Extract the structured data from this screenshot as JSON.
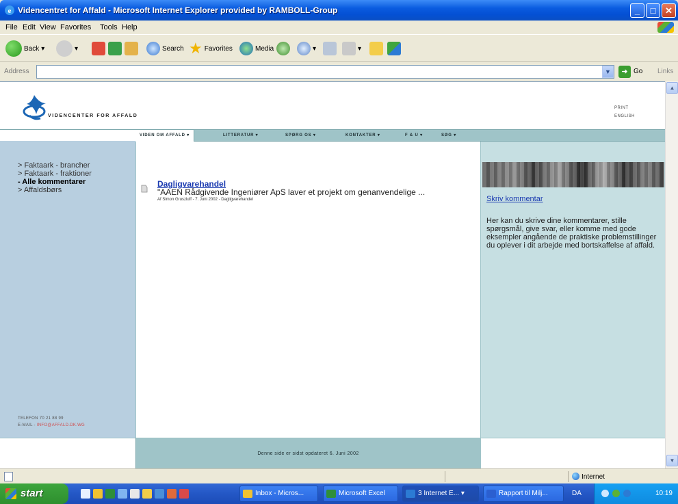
{
  "window": {
    "title": "Videncentret for Affald - Microsoft Internet Explorer provided by RAMBOLL-Group"
  },
  "menu": [
    "File",
    "Edit",
    "View",
    "Favorites",
    "Tools",
    "Help"
  ],
  "toolbar": {
    "back_label": "Back",
    "search_label": "Search",
    "favorites_label": "Favorites",
    "media_label": "Media"
  },
  "address": {
    "label": "Address",
    "value": "",
    "go_label": "Go",
    "links_label": "Links"
  },
  "site": {
    "logo_text": "VIDENCENTER FOR AFFALD",
    "lang_links": [
      "PRINT",
      "ENGLISH"
    ],
    "nav": [
      {
        "label": "VIDEN OM AFFALD ▾",
        "active": true
      },
      {
        "label": "LITTERATUR ▾",
        "active": false
      },
      {
        "label": "SPØRG OS ▾",
        "active": false
      },
      {
        "label": "KONTAKTER ▾",
        "active": false
      },
      {
        "label": "F & U ▾",
        "active": false
      },
      {
        "label": "SØG ▾",
        "active": false
      }
    ],
    "sidebar": [
      {
        "label": "> Faktaark - brancher",
        "active": false
      },
      {
        "label": "> Faktaark - fraktioner",
        "active": false
      },
      {
        "label": "- Alle kommentarer",
        "active": true
      },
      {
        "label": "> Affaldsbørs",
        "active": false
      }
    ],
    "contact": {
      "phone": "TELEFON 70 21 88 99",
      "email_label": "E-MAIL -",
      "email": "INFO@AFFALD.DK.WG"
    },
    "article": {
      "title": "Dagligvarehandel",
      "excerpt": "\"AAEN Rådgivende Ingeniører ApS laver et projekt om genanvendelige ...",
      "meta": "Af Simon Gruszluff - 7. Juni 2002 - Dagligvarehandel"
    },
    "right": {
      "cta": "Skriv kommentar",
      "description": "Her kan du skrive dine kommentarer, stille spørgsmål, give svar, eller komme med gode eksempler angående de praktiske problemstillinger du oplever i dit arbejde med bortskaffelse af affald."
    },
    "footer": "Denne side er sidst opdateret 6. Juni 2002"
  },
  "status": {
    "zone": "Internet"
  },
  "taskbar": {
    "start": "start",
    "tasks": [
      {
        "label": "Inbox - Micros...",
        "icon_color": "#f1c232",
        "active": false
      },
      {
        "label": "Microsoft Excel",
        "icon_color": "#2f8f3a",
        "active": false
      },
      {
        "label": "3 Internet E...",
        "icon_color": "#2c7bd4",
        "active": true
      },
      {
        "label": "Rapport til Milj...",
        "icon_color": "#2b5fd0",
        "active": false
      }
    ],
    "lang": "DA",
    "clock": "10:19"
  }
}
